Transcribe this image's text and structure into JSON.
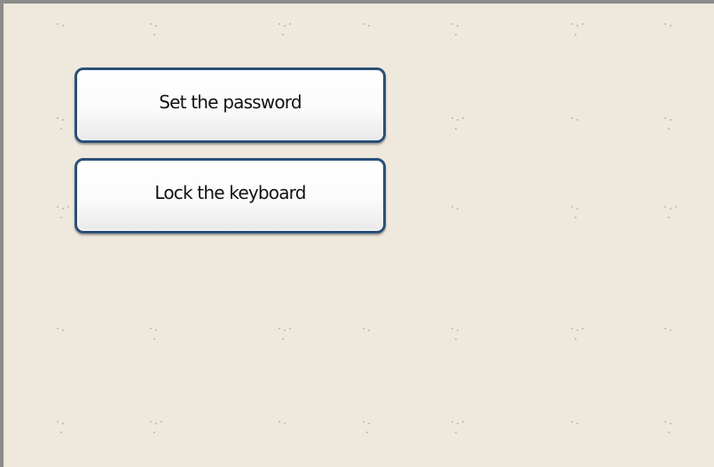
{
  "menu": {
    "set_password_label": "Set the password",
    "lock_keyboard_label": "Lock the keyboard"
  },
  "colors": {
    "background": "#efe8dd",
    "button_border": "#2b5077",
    "frame": "#8c8c8c"
  }
}
